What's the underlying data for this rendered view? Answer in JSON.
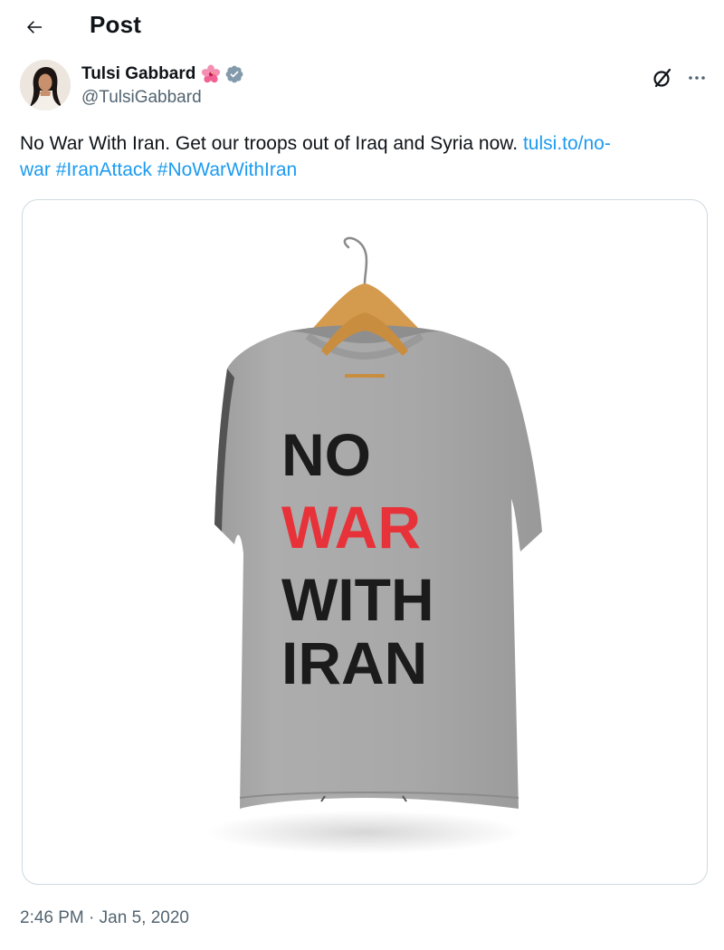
{
  "header": {
    "title": "Post",
    "back_icon": "arrow-left-icon"
  },
  "author": {
    "display_name": "Tulsi Gabbard",
    "handle": "@TulsiGabbard",
    "name_emoji": "hibiscus-icon",
    "verified_badge": "verified-badge-icon",
    "verified_color": "#829aab"
  },
  "actions": {
    "grok_icon": "grok-icon",
    "more_icon": "more-options-icon"
  },
  "tweet": {
    "text_plain": "No War With Iran. Get our troops out of Iraq and Syria now. ",
    "link_text": "tulsi.to/no-war",
    "link_part1": "tulsi.to/no-",
    "link_part2": "war",
    "hashtag_1": "#IranAttack",
    "hashtag_2": "#NoWarWithIran",
    "link_color": "#1d9bf0"
  },
  "media": {
    "shirt_line_1": "NO",
    "shirt_line_2": "WAR",
    "shirt_line_3": "WITH",
    "shirt_line_4": "IRAN",
    "shirt_color": "#a9a9a9",
    "accent_red": "#e8323a"
  },
  "meta": {
    "time": "2:46 PM",
    "separator": " · ",
    "date": "Jan 5, 2020"
  }
}
